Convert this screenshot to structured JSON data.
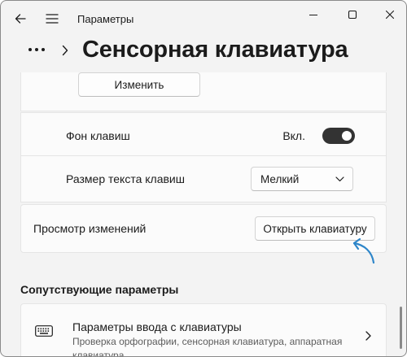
{
  "window": {
    "app_title": "Параметры"
  },
  "header": {
    "page_title": "Сенсорная клавиатура"
  },
  "top_card": {
    "button_label": "Изменить"
  },
  "key_background": {
    "label": "Фон клавиш",
    "toggle_state_label": "Вкл.",
    "toggle_on": true
  },
  "key_text_size": {
    "label": "Размер текста клавиш",
    "selected": "Мелкий"
  },
  "preview": {
    "label": "Просмотр изменений",
    "button_label": "Открыть клавиатуру"
  },
  "related": {
    "section_title": "Сопутствующие параметры",
    "items": [
      {
        "title": "Параметры ввода с клавиатуры",
        "description": "Проверка орфографии, сенсорная клавиатура, аппаратная клавиатура"
      }
    ]
  },
  "colors": {
    "window_bg": "#f3f3f3",
    "card_bg": "#fbfbfb",
    "toggle_on": "#333333",
    "hint_arrow": "#2e86c9"
  },
  "icons": {
    "back": "back-arrow-icon",
    "menu": "hamburger-menu-icon",
    "minimize": "minimize-icon",
    "maximize": "maximize-icon",
    "close": "close-icon",
    "more": "more-dots-icon",
    "breadcrumb": "chevron-right-icon",
    "keyboard": "keyboard-icon",
    "dropdown": "chevron-down-icon"
  }
}
